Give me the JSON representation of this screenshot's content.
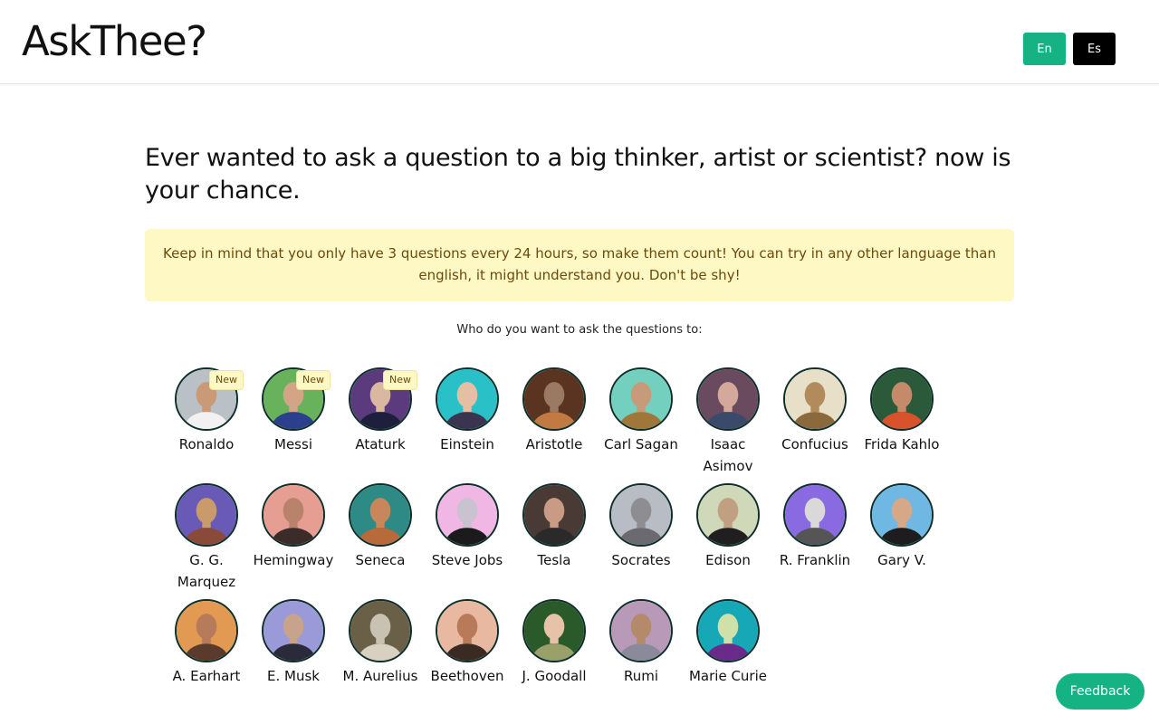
{
  "header": {
    "logo": "AskThee?",
    "lang_en": "En",
    "lang_es": "Es"
  },
  "headline": "Ever wanted to ask a question to a big thinker, artist or scientist? now is your chance.",
  "notice": "Keep in mind that you only have 3 questions every 24 hours, so make them count!  You can try in any other language than english, it might understand you. Don't be shy!",
  "prompt": "Who do you want to ask the questions to:",
  "badge_label": "New",
  "people": [
    {
      "name": "Ronaldo",
      "new": true,
      "bg": "#b9c1c7",
      "skin": "#c99a75",
      "cloth": "#f1f1f1"
    },
    {
      "name": "Messi",
      "new": true,
      "bg": "#67b25b",
      "skin": "#d3a586",
      "cloth": "#2b3f8c"
    },
    {
      "name": "Ataturk",
      "new": true,
      "bg": "#5b3a7e",
      "skin": "#d9b7a0",
      "cloth": "#1e1f3d"
    },
    {
      "name": "Einstein",
      "new": false,
      "bg": "#2ac0c7",
      "skin": "#e4bfa4",
      "cloth": "#3a3450"
    },
    {
      "name": "Aristotle",
      "new": false,
      "bg": "#5a3420",
      "skin": "#9a7a62",
      "cloth": "#c07a42"
    },
    {
      "name": "Carl Sagan",
      "new": false,
      "bg": "#73d0bf",
      "skin": "#c79a79",
      "cloth": "#a0773a"
    },
    {
      "name": "Isaac Asimov",
      "new": false,
      "bg": "#6a4a5e",
      "skin": "#d4a89a",
      "cloth": "#3a4a6a"
    },
    {
      "name": "Confucius",
      "new": false,
      "bg": "#e8dfc8",
      "skin": "#b28b5c",
      "cloth": "#8a6a3c"
    },
    {
      "name": "Frida Kahlo",
      "new": false,
      "bg": "#2a5a3a",
      "skin": "#c48a6a",
      "cloth": "#d8532b"
    },
    {
      "name": "G. G. Marquez",
      "new": false,
      "bg": "#6a5ab8",
      "skin": "#c99a6a",
      "cloth": "#8a4a3a"
    },
    {
      "name": "Hemingway",
      "new": false,
      "bg": "#e79e92",
      "skin": "#b9826a",
      "cloth": "#3b2c2a"
    },
    {
      "name": "Seneca",
      "new": false,
      "bg": "#2e8a84",
      "skin": "#c9865a",
      "cloth": "#b86a3a"
    },
    {
      "name": "Steve Jobs",
      "new": false,
      "bg": "#f0b6e4",
      "skin": "#c9c2d1",
      "cloth": "#1b1b1b"
    },
    {
      "name": "Tesla",
      "new": false,
      "bg": "#4a3a36",
      "skin": "#c99a84",
      "cloth": "#2a2a2a"
    },
    {
      "name": "Socrates",
      "new": false,
      "bg": "#b8bcc4",
      "skin": "#8e8e92",
      "cloth": "#6a6a70"
    },
    {
      "name": "Edison",
      "new": false,
      "bg": "#cfd8b8",
      "skin": "#c0a080",
      "cloth": "#1f1f1f"
    },
    {
      "name": "R. Franklin",
      "new": false,
      "bg": "#8a6ae0",
      "skin": "#dad8d8",
      "cloth": "#555"
    },
    {
      "name": "Gary V.",
      "new": false,
      "bg": "#6fb8e4",
      "skin": "#d6a888",
      "cloth": "#1d1d1d"
    },
    {
      "name": "A. Earhart",
      "new": false,
      "bg": "#e29a52",
      "skin": "#b77a5a",
      "cloth": "#5a3a2a"
    },
    {
      "name": "E. Musk",
      "new": false,
      "bg": "#9a9ad8",
      "skin": "#c6a38a",
      "cloth": "#2a2a3a"
    },
    {
      "name": "M. Aurelius",
      "new": false,
      "bg": "#6a6048",
      "skin": "#c8c2b2",
      "cloth": "#d8d0c0"
    },
    {
      "name": "Beethoven",
      "new": false,
      "bg": "#e8b8a0",
      "skin": "#b97a5a",
      "cloth": "#3a2a22"
    },
    {
      "name": "J. Goodall",
      "new": false,
      "bg": "#2a5a2a",
      "skin": "#e6c2a8",
      "cloth": "#9aa06a"
    },
    {
      "name": "Rumi",
      "new": false,
      "bg": "#b89ab8",
      "skin": "#b48a6a",
      "cloth": "#8a8a9a"
    },
    {
      "name": "Marie Curie",
      "new": false,
      "bg": "#17a8b8",
      "skin": "#cfe0a8",
      "cloth": "#6a2a8a"
    }
  ],
  "feedback": "Feedback"
}
